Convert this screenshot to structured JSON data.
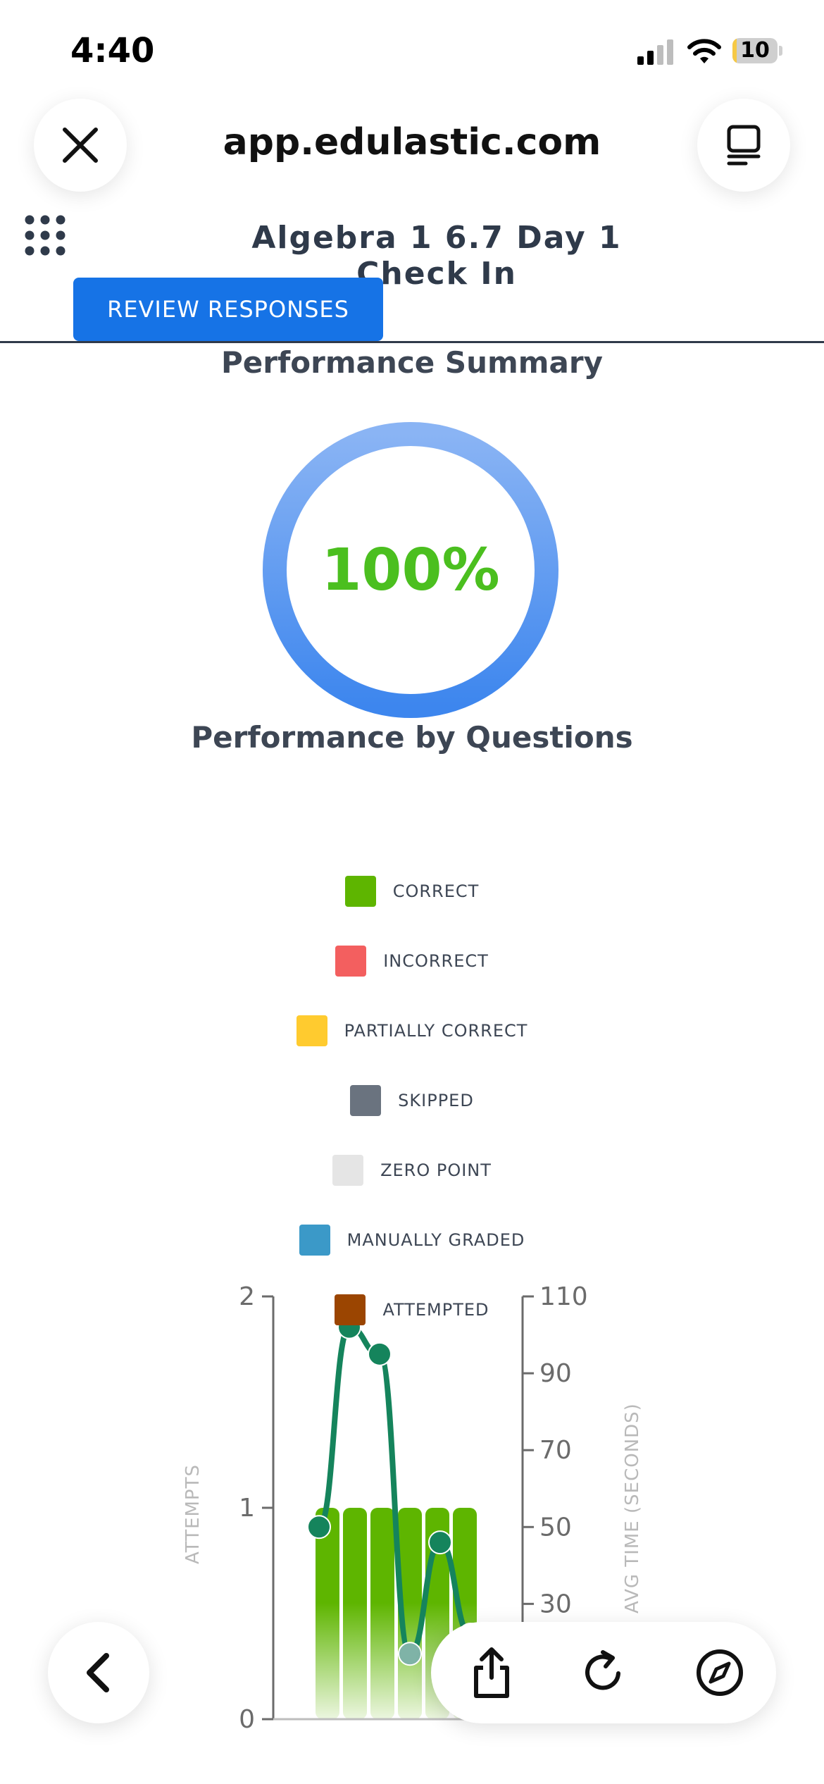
{
  "status_bar": {
    "time": "4:40",
    "battery_level": "10",
    "battery_fraction": 0.1,
    "icons": [
      "cellular-signal-icon",
      "wifi-icon",
      "battery-icon"
    ]
  },
  "browser": {
    "url": "app.edulastic.com",
    "icons": [
      "close-icon",
      "reader-mode-icon",
      "back-icon",
      "share-icon",
      "reload-icon",
      "compass-icon"
    ]
  },
  "app": {
    "title": "Algebra 1 6.7 Day 1 Check In",
    "review_button": "REVIEW RESPONSES",
    "performance_summary_heading": "Performance Summary",
    "score_percent": "100%",
    "score_fraction": 1.0,
    "performance_by_questions_heading": "Performance by Questions"
  },
  "legend": [
    {
      "label": "CORRECT",
      "color": "#5eb500"
    },
    {
      "label": "INCORRECT",
      "color": "#f35f5f"
    },
    {
      "label": "PARTIALLY CORRECT",
      "color": "#ffcb2f"
    },
    {
      "label": "SKIPPED",
      "color": "#6a737f"
    },
    {
      "label": "ZERO POINT",
      "color": "#e5e5e5"
    },
    {
      "label": "MANUALLY GRADED",
      "color": "#3b99c8"
    },
    {
      "label": "ATTEMPTED",
      "color": "#9b4501"
    }
  ],
  "colors": {
    "primary_button": "#1673e6",
    "score_text": "#4bbf1f",
    "donut_start": "#3d86ee",
    "donut_end": "#8ab4f4",
    "line_series": "#15845c"
  },
  "chart_data": {
    "type": "bar",
    "ylabel": "ATTEMPTS",
    "y2label": "AVG TIME (SECONDS)",
    "ylim": [
      0,
      2
    ],
    "y_ticks": [
      "0",
      "1",
      "2"
    ],
    "y2_ticks": [
      "30",
      "50",
      "70",
      "90",
      "110"
    ],
    "y2lim": [
      0,
      110
    ],
    "series": [
      {
        "name": "CORRECT",
        "kind": "bar",
        "values": [
          1,
          1,
          1,
          1,
          1,
          1
        ]
      },
      {
        "kind": "line",
        "axis": "y2",
        "values": [
          50,
          102,
          95,
          17,
          46,
          22
        ]
      }
    ]
  }
}
